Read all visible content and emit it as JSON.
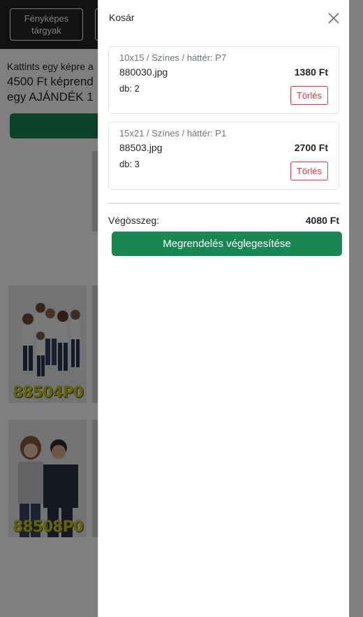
{
  "nav": {
    "photo_items": "Fényképes tárgyak"
  },
  "intro": {
    "hint": "Kattints egy képre a",
    "offer_line1": "4500 Ft képrend",
    "offer_line2": "egy AJÁNDÉK 1"
  },
  "gallery": {
    "items": [
      {
        "code": "88504P0"
      },
      {
        "code": "88508P0"
      }
    ]
  },
  "cart": {
    "title": "Kosár",
    "items": [
      {
        "description": "10x15 / Színes / háttér: P7",
        "file": "880030.jpg",
        "price": "1380 Ft",
        "qty": "db: 2",
        "delete_label": "Törlés"
      },
      {
        "description": "15x21 / Színes / háttér: P1",
        "file": "88503.jpg",
        "price": "2700 Ft",
        "qty": "db: 3",
        "delete_label": "Törlés"
      }
    ],
    "total_label": "Végösszeg:",
    "total_value": "4080 Ft",
    "checkout_label": "Megrendelés véglegesítése"
  },
  "colors": {
    "primary_green": "#198754",
    "danger_red": "#dc3545",
    "dark_nav": "#212529"
  },
  "icons": {
    "close": "close-icon"
  }
}
